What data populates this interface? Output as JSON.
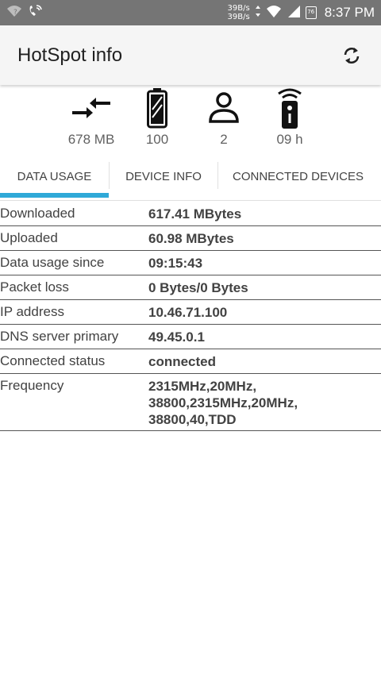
{
  "status_bar": {
    "speed_up": "39B/s",
    "speed_down": "39B/s",
    "calendar_day": "76",
    "time": "8:37 PM"
  },
  "app_bar": {
    "title": "HotSpot info"
  },
  "stats": [
    {
      "icon": "data-transfer-icon",
      "value": "678 MB"
    },
    {
      "icon": "battery-icon",
      "value": "100"
    },
    {
      "icon": "person-icon",
      "value": "2"
    },
    {
      "icon": "router-signal-icon",
      "value": "09 h"
    }
  ],
  "tabs": [
    {
      "label": "DATA USAGE",
      "selected": true
    },
    {
      "label": "DEVICE INFO",
      "selected": false
    },
    {
      "label": "CONNECTED DEVICES",
      "selected": false
    }
  ],
  "info_rows": [
    {
      "label": "Downloaded",
      "value": "617.41 MBytes"
    },
    {
      "label": "Uploaded",
      "value": "60.98 MBytes"
    },
    {
      "label": "Data usage since",
      "value": "09:15:43"
    },
    {
      "label": "Packet loss",
      "value": "0 Bytes/0 Bytes"
    },
    {
      "label": "IP address",
      "value": "10.46.71.100"
    },
    {
      "label": "DNS server primary",
      "value": "49.45.0.1"
    },
    {
      "label": "Connected status",
      "value": "connected"
    },
    {
      "label": "Frequency",
      "value_lines": [
        "2315MHz,20MHz,",
        "38800,2315MHz,20MHz,",
        "38800,40,TDD"
      ]
    }
  ],
  "colors": {
    "status_bar": "#757575",
    "app_bar": "#f5f5f5",
    "tab_indicator": "#2fa9d8"
  }
}
